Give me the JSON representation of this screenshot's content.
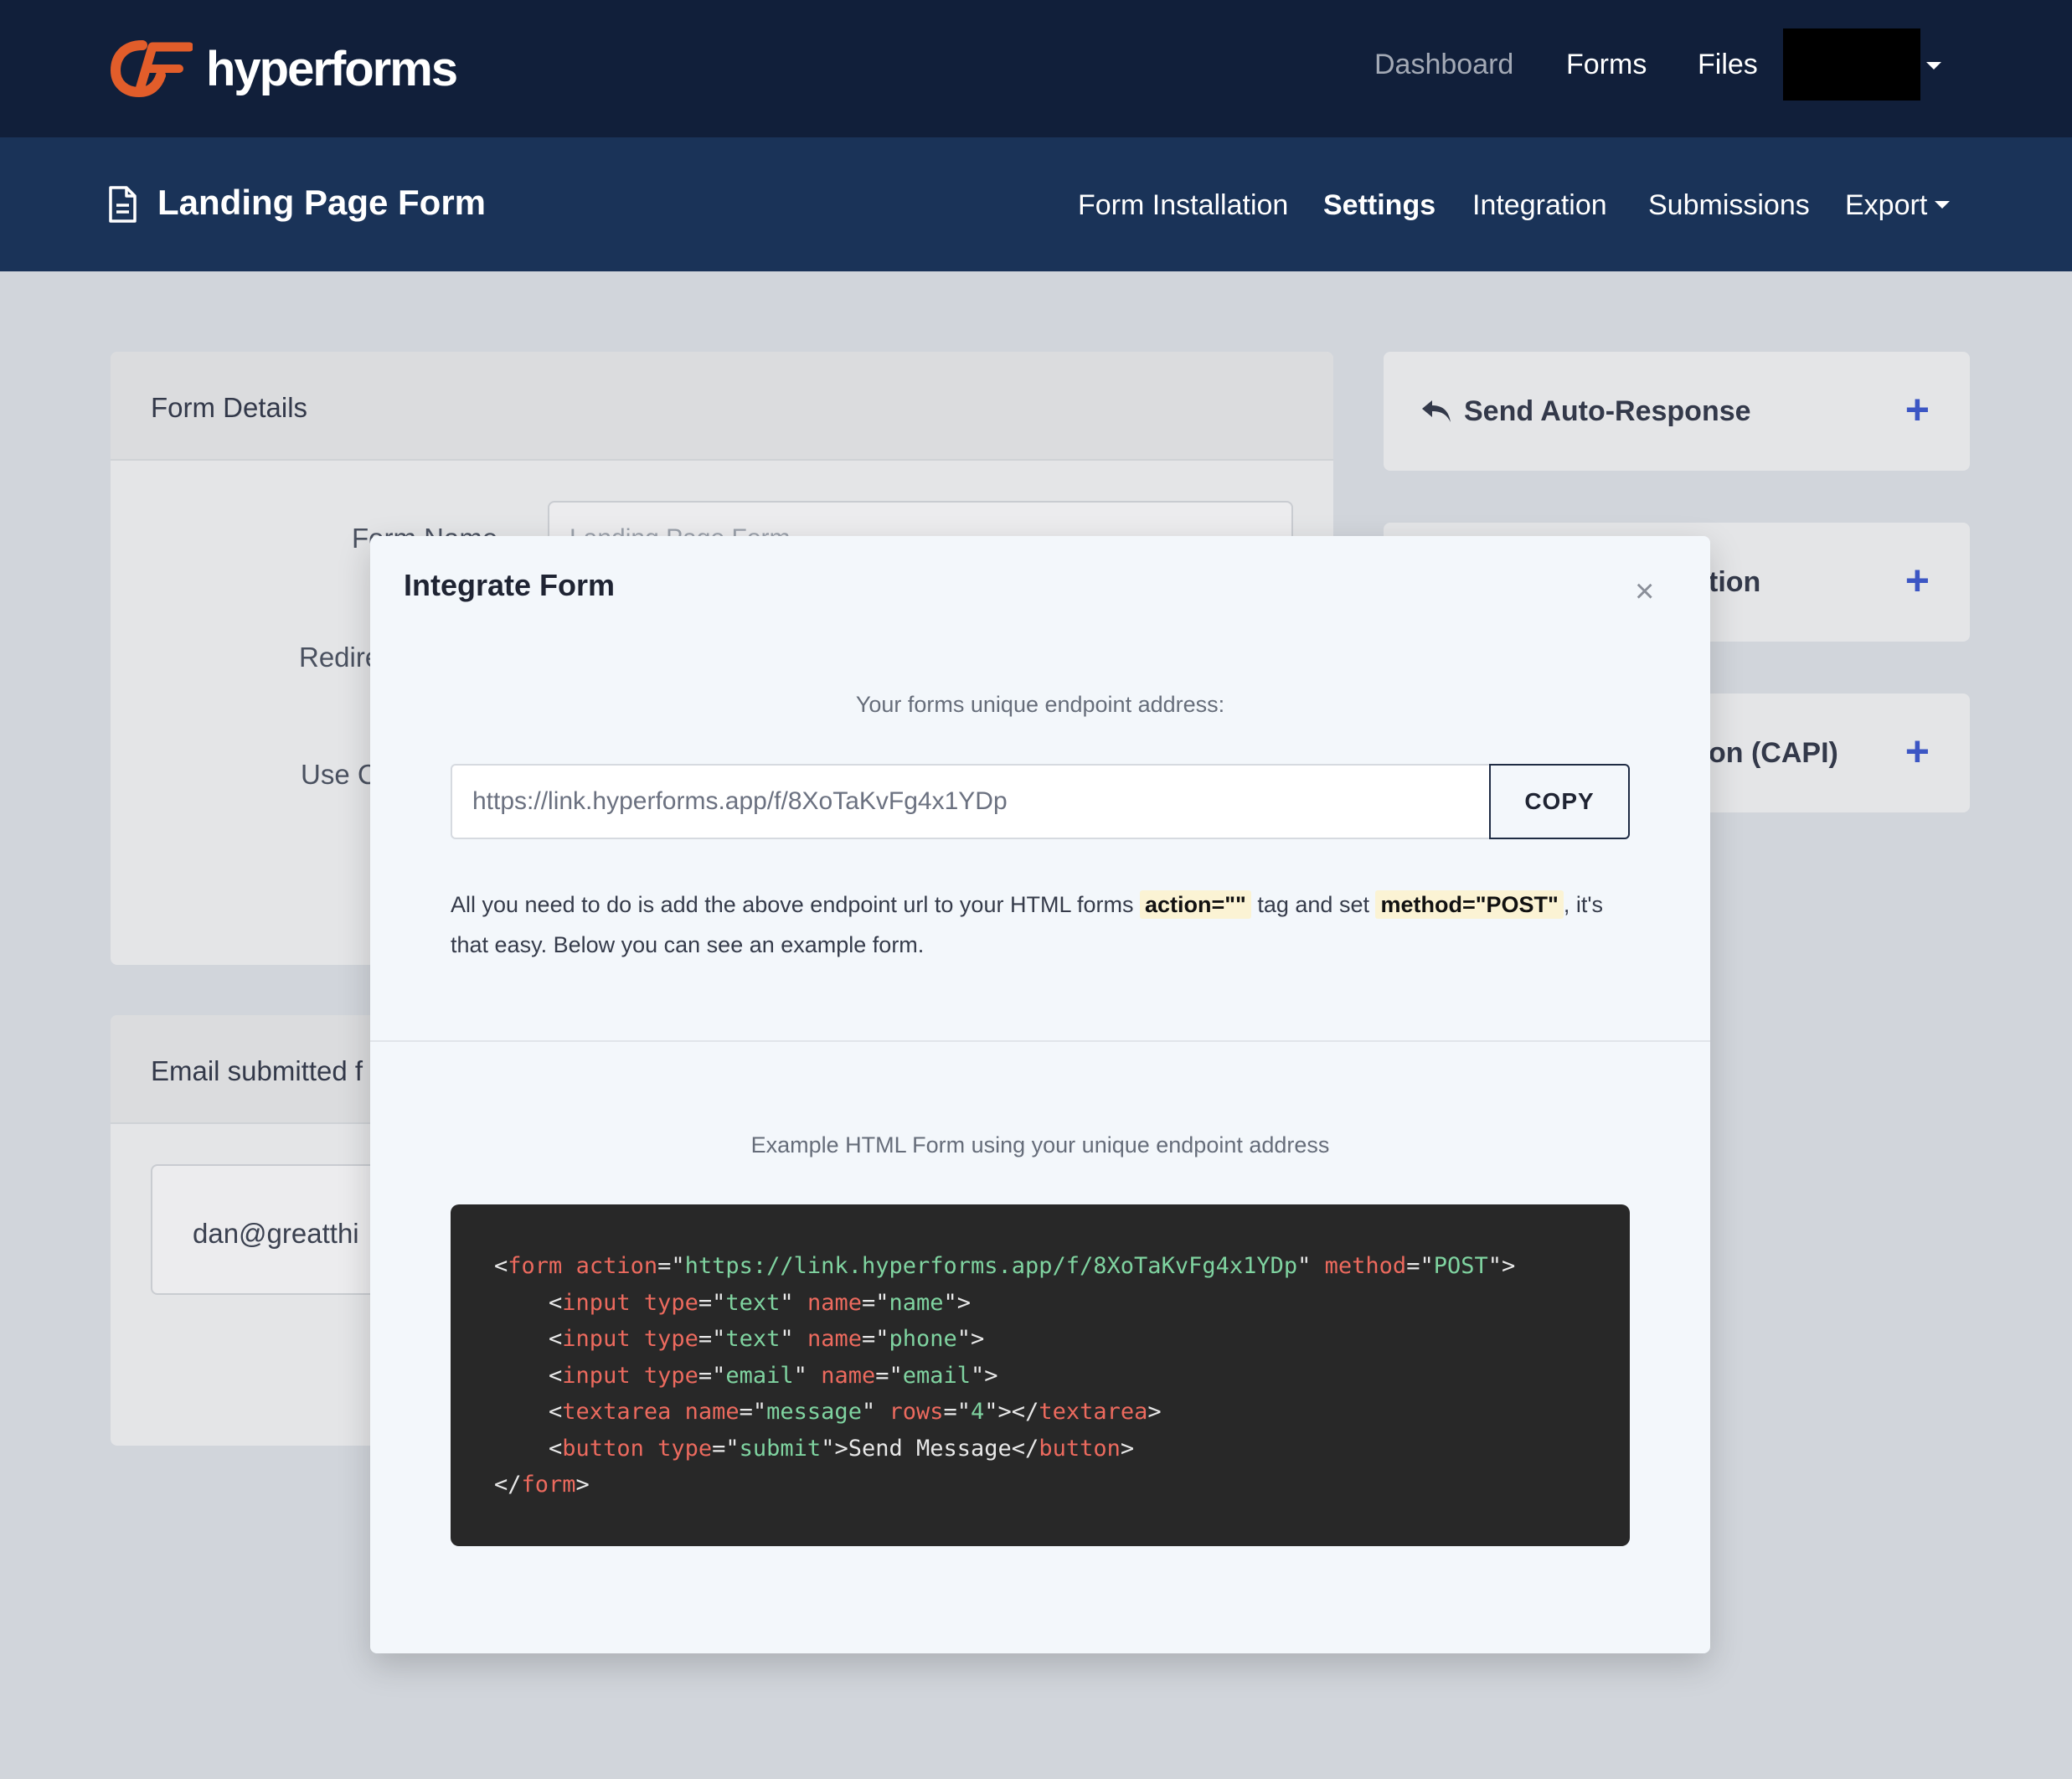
{
  "nav": {
    "logo_text": "hyperforms",
    "links": [
      "Dashboard",
      "Forms",
      "Files"
    ]
  },
  "subheader": {
    "form_title": "Landing Page Form",
    "tabs": [
      "Form Installation",
      "Settings",
      "Integration",
      "Submissions",
      "Export"
    ],
    "active_tab": "Settings"
  },
  "form_details": {
    "title": "Form Details",
    "label_form_name": "Form Name",
    "label_redirect": "Redire",
    "label_use": "Use C",
    "form_name_placeholder": "Landing Page Form"
  },
  "email_card": {
    "title": "Email submitted f",
    "email_value": "dan@greatthi"
  },
  "side_cards": [
    {
      "title": "Send Auto-Response"
    },
    {
      "title": "tion"
    },
    {
      "title": "on (CAPI)"
    }
  ],
  "modal": {
    "title": "Integrate Form",
    "close_label": "×",
    "endpoint_caption": "Your forms unique endpoint address:",
    "endpoint_url": "https://link.hyperforms.app/f/8XoTaKvFg4x1YDp",
    "copy_label": "COPY",
    "instruction_pre": "All you need to do is add the above endpoint url to your HTML forms ",
    "instruction_action": "action=\"\"",
    "instruction_mid": " tag and set ",
    "instruction_method": "method=\"POST\"",
    "instruction_post": ", it's that easy. Below you can see an example form.",
    "example_caption": "Example HTML Form using your unique endpoint address",
    "code": {
      "form_action": "https://link.hyperforms.app/f/8XoTaKvFg4x1YDp",
      "form_method": "POST",
      "input1_type": "text",
      "input1_name": "name",
      "input2_type": "text",
      "input2_name": "phone",
      "input3_type": "email",
      "input3_name": "email",
      "textarea_name": "message",
      "textarea_rows": "4",
      "button_type": "submit",
      "button_text": "Send Message"
    }
  },
  "colors": {
    "topnav_bg": "#111f3a",
    "subheader_bg": "#1a3358",
    "logo_orange": "#e25d2a",
    "plus_blue": "#3c56c4",
    "code_bg": "#282828"
  }
}
